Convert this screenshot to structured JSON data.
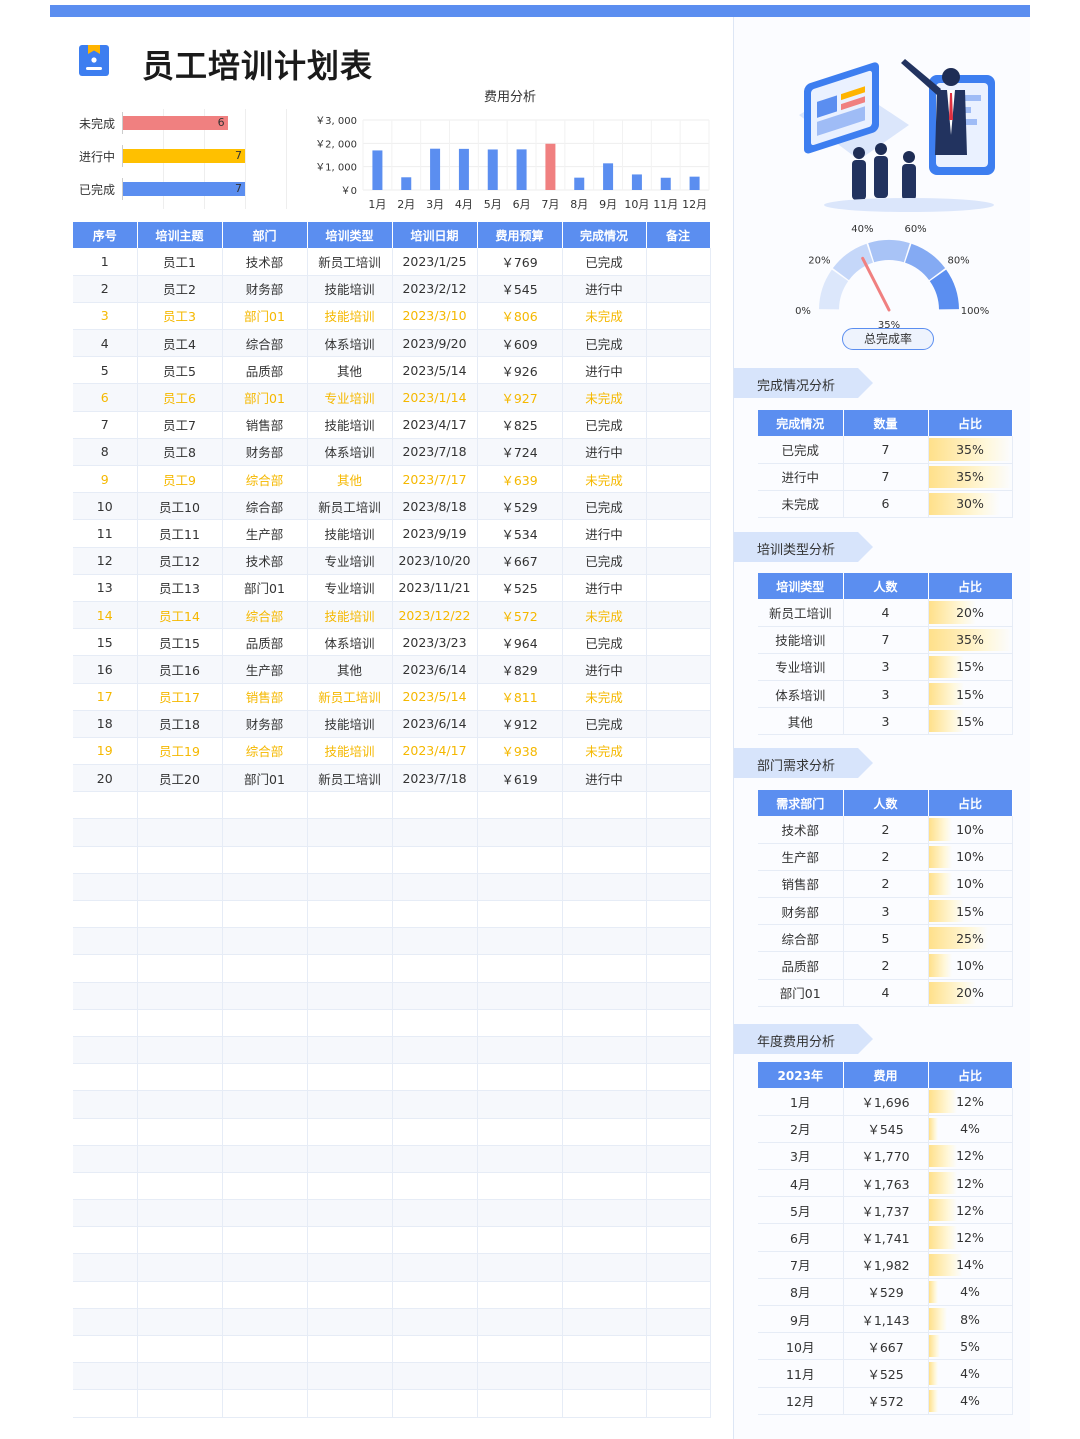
{
  "title": "员工培训计划表",
  "status_chart": {
    "items": [
      {
        "label": "未完成",
        "value": 6,
        "color": "#f08080"
      },
      {
        "label": "进行中",
        "value": 7,
        "color": "#ffc000"
      },
      {
        "label": "已完成",
        "value": 7,
        "color": "#5b8ef0"
      }
    ],
    "max": 7
  },
  "chart_data": {
    "type": "bar",
    "title": "费用分析",
    "categories": [
      "1月",
      "2月",
      "3月",
      "4月",
      "5月",
      "6月",
      "7月",
      "8月",
      "9月",
      "10月",
      "11月",
      "12月"
    ],
    "values": [
      1696,
      545,
      1770,
      1763,
      1737,
      1741,
      1982,
      529,
      1143,
      667,
      525,
      572
    ],
    "highlight_index": 6,
    "yticks": [
      "￥3, 000",
      "￥2, 000",
      "￥1, 000",
      "￥0"
    ],
    "ylim": [
      0,
      3000
    ],
    "color": "#5b8ef0",
    "highlight_color": "#f08080"
  },
  "table": {
    "headers": [
      "序号",
      "培训主题",
      "部门",
      "培训类型",
      "培训日期",
      "费用预算",
      "完成情况",
      "备注"
    ],
    "rows": [
      [
        "1",
        "员工1",
        "技术部",
        "新员工培训",
        "2023/1/25",
        "￥769",
        "已完成",
        ""
      ],
      [
        "2",
        "员工2",
        "财务部",
        "技能培训",
        "2023/2/12",
        "￥545",
        "进行中",
        ""
      ],
      [
        "3",
        "员工3",
        "部门01",
        "技能培训",
        "2023/3/10",
        "￥806",
        "未完成",
        ""
      ],
      [
        "4",
        "员工4",
        "综合部",
        "体系培训",
        "2023/9/20",
        "￥609",
        "已完成",
        ""
      ],
      [
        "5",
        "员工5",
        "品质部",
        "其他",
        "2023/5/14",
        "￥926",
        "进行中",
        ""
      ],
      [
        "6",
        "员工6",
        "部门01",
        "专业培训",
        "2023/1/14",
        "￥927",
        "未完成",
        ""
      ],
      [
        "7",
        "员工7",
        "销售部",
        "技能培训",
        "2023/4/17",
        "￥825",
        "已完成",
        ""
      ],
      [
        "8",
        "员工8",
        "财务部",
        "体系培训",
        "2023/7/18",
        "￥724",
        "进行中",
        ""
      ],
      [
        "9",
        "员工9",
        "综合部",
        "其他",
        "2023/7/17",
        "￥639",
        "未完成",
        ""
      ],
      [
        "10",
        "员工10",
        "综合部",
        "新员工培训",
        "2023/8/18",
        "￥529",
        "已完成",
        ""
      ],
      [
        "11",
        "员工11",
        "生产部",
        "技能培训",
        "2023/9/19",
        "￥534",
        "进行中",
        ""
      ],
      [
        "12",
        "员工12",
        "技术部",
        "专业培训",
        "2023/10/20",
        "￥667",
        "已完成",
        ""
      ],
      [
        "13",
        "员工13",
        "部门01",
        "专业培训",
        "2023/11/21",
        "￥525",
        "进行中",
        ""
      ],
      [
        "14",
        "员工14",
        "综合部",
        "技能培训",
        "2023/12/22",
        "￥572",
        "未完成",
        ""
      ],
      [
        "15",
        "员工15",
        "品质部",
        "体系培训",
        "2023/3/23",
        "￥964",
        "已完成",
        ""
      ],
      [
        "16",
        "员工16",
        "生产部",
        "其他",
        "2023/6/14",
        "￥829",
        "进行中",
        ""
      ],
      [
        "17",
        "员工17",
        "销售部",
        "新员工培训",
        "2023/5/14",
        "￥811",
        "未完成",
        ""
      ],
      [
        "18",
        "员工18",
        "财务部",
        "技能培训",
        "2023/6/14",
        "￥912",
        "已完成",
        ""
      ],
      [
        "19",
        "员工19",
        "综合部",
        "技能培训",
        "2023/4/17",
        "￥938",
        "未完成",
        ""
      ],
      [
        "20",
        "员工20",
        "部门01",
        "新员工培训",
        "2023/7/18",
        "￥619",
        "进行中",
        ""
      ]
    ],
    "empty_rows": 23,
    "warn_status": "未完成",
    "warn_color": "#f5b800"
  },
  "gauge": {
    "labels": [
      "0%",
      "20%",
      "40%",
      "60%",
      "80%",
      "100%"
    ],
    "value_label": "35%",
    "value": 0.35,
    "button": "总完成率"
  },
  "sections": [
    {
      "title": "完成情况分析",
      "headers": [
        "完成情况",
        "数量",
        "占比"
      ],
      "rows": [
        [
          "已完成",
          "7",
          "35%"
        ],
        [
          "进行中",
          "7",
          "35%"
        ],
        [
          "未完成",
          "6",
          "30%"
        ]
      ],
      "fractions": [
        0.35,
        0.35,
        0.3
      ]
    },
    {
      "title": "培训类型分析",
      "headers": [
        "培训类型",
        "人数",
        "占比"
      ],
      "rows": [
        [
          "新员工培训",
          "4",
          "20%"
        ],
        [
          "技能培训",
          "7",
          "35%"
        ],
        [
          "专业培训",
          "3",
          "15%"
        ],
        [
          "体系培训",
          "3",
          "15%"
        ],
        [
          "其他",
          "3",
          "15%"
        ]
      ],
      "fractions": [
        0.2,
        0.35,
        0.15,
        0.15,
        0.15
      ]
    },
    {
      "title": "部门需求分析",
      "headers": [
        "需求部门",
        "人数",
        "占比"
      ],
      "rows": [
        [
          "技术部",
          "2",
          "10%"
        ],
        [
          "生产部",
          "2",
          "10%"
        ],
        [
          "销售部",
          "2",
          "10%"
        ],
        [
          "财务部",
          "3",
          "15%"
        ],
        [
          "综合部",
          "5",
          "25%"
        ],
        [
          "品质部",
          "2",
          "10%"
        ],
        [
          "部门01",
          "4",
          "20%"
        ]
      ],
      "fractions": [
        0.1,
        0.1,
        0.1,
        0.15,
        0.25,
        0.1,
        0.2
      ]
    },
    {
      "title": "年度费用分析",
      "headers": [
        "2023年",
        "费用",
        "占比"
      ],
      "rows": [
        [
          "1月",
          "￥1,696",
          "12%"
        ],
        [
          "2月",
          "￥545",
          "4%"
        ],
        [
          "3月",
          "￥1,770",
          "12%"
        ],
        [
          "4月",
          "￥1,763",
          "12%"
        ],
        [
          "5月",
          "￥1,737",
          "12%"
        ],
        [
          "6月",
          "￥1,741",
          "12%"
        ],
        [
          "7月",
          "￥1,982",
          "14%"
        ],
        [
          "8月",
          "￥529",
          "4%"
        ],
        [
          "9月",
          "￥1,143",
          "8%"
        ],
        [
          "10月",
          "￥667",
          "5%"
        ],
        [
          "11月",
          "￥525",
          "4%"
        ],
        [
          "12月",
          "￥572",
          "4%"
        ]
      ],
      "fractions": [
        0.12,
        0.04,
        0.12,
        0.12,
        0.12,
        0.12,
        0.14,
        0.04,
        0.08,
        0.05,
        0.04,
        0.04
      ]
    }
  ]
}
